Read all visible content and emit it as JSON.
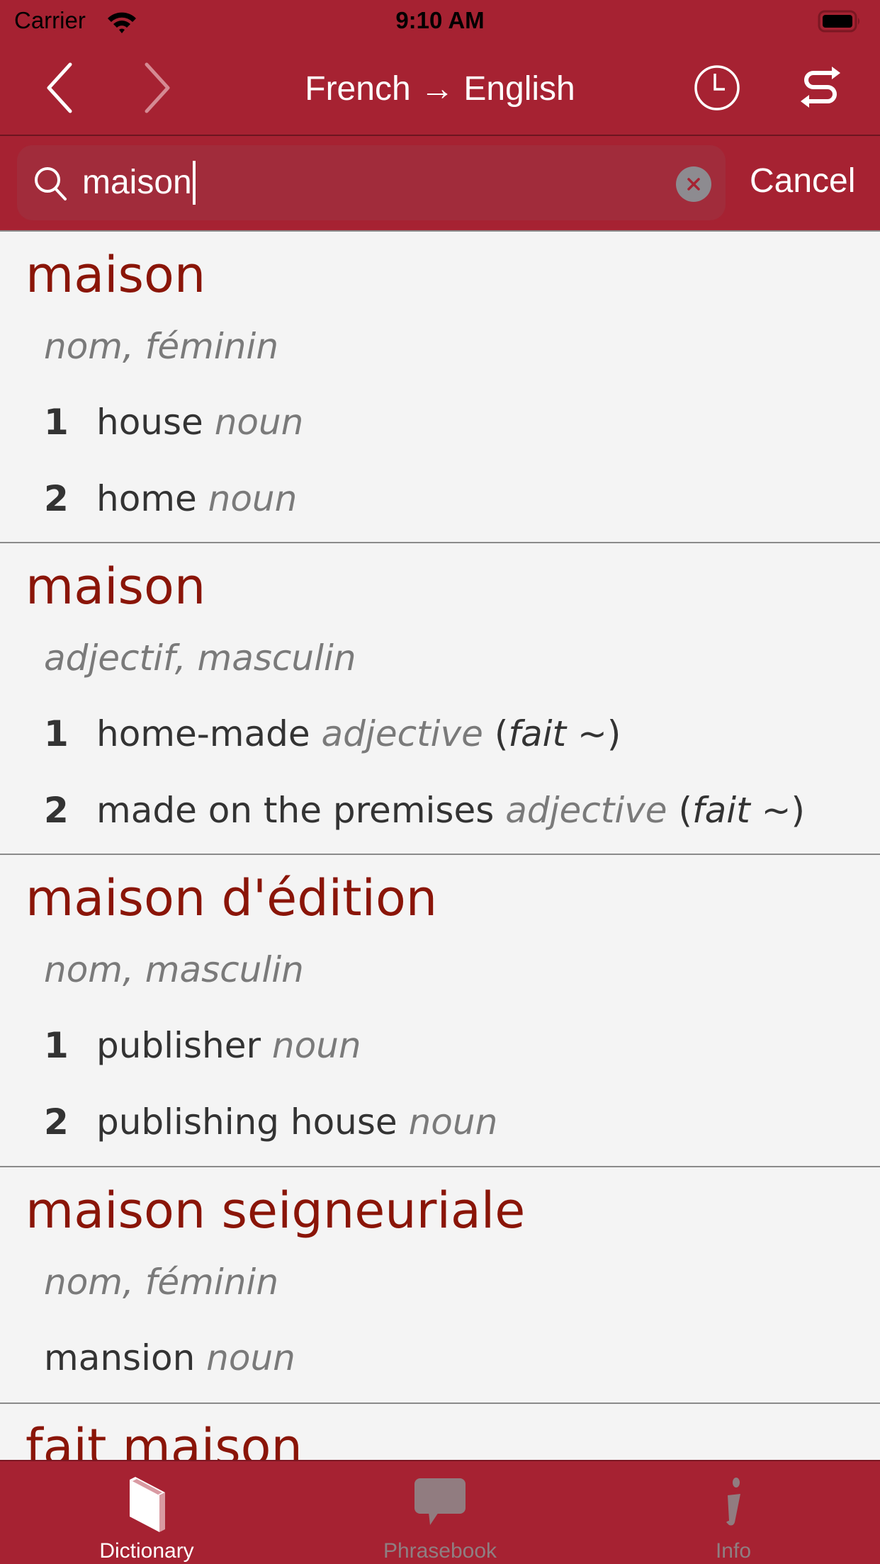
{
  "status_bar": {
    "carrier": "Carrier",
    "time": "9:10 AM"
  },
  "nav": {
    "title": "French → English",
    "back_icon": "chevron-left-icon",
    "forward_icon": "chevron-right-icon",
    "history_icon": "clock-icon",
    "swap_icon": "swap-direction-icon"
  },
  "search": {
    "value": "maison",
    "cancel_label": "Cancel"
  },
  "entries": [
    {
      "headword": "maison",
      "grammar": "nom, féminin",
      "senses": [
        {
          "num": "1",
          "text": "house",
          "pos": "noun"
        },
        {
          "num": "2",
          "text": "home",
          "pos": "noun"
        }
      ]
    },
    {
      "headword": "maison",
      "grammar": "adjectif, masculin",
      "senses": [
        {
          "num": "1",
          "text": "home-made",
          "pos": "adjective",
          "context": "fait ~"
        },
        {
          "num": "2",
          "text": "made on the premises",
          "pos": "adjective",
          "context": "fait ~"
        }
      ]
    },
    {
      "headword": "maison d'édition",
      "grammar": "nom, masculin",
      "senses": [
        {
          "num": "1",
          "text": "publisher",
          "pos": "noun"
        },
        {
          "num": "2",
          "text": "publishing house",
          "pos": "noun"
        }
      ]
    },
    {
      "headword": "maison seigneuriale",
      "grammar": "nom, féminin",
      "senses": [
        {
          "text": "mansion",
          "pos": "noun"
        }
      ]
    },
    {
      "headword": "fait maison"
    }
  ],
  "tabs": [
    {
      "label": "Dictionary",
      "icon": "book-icon",
      "active": true
    },
    {
      "label": "Phrasebook",
      "icon": "speech-bubble-icon",
      "active": false
    },
    {
      "label": "Info",
      "icon": "info-icon",
      "active": false
    }
  ],
  "colors": {
    "brand": "#a62232",
    "headword": "#8a1508",
    "muted": "#7a7a7a",
    "tab_inactive": "#8f7f82"
  }
}
